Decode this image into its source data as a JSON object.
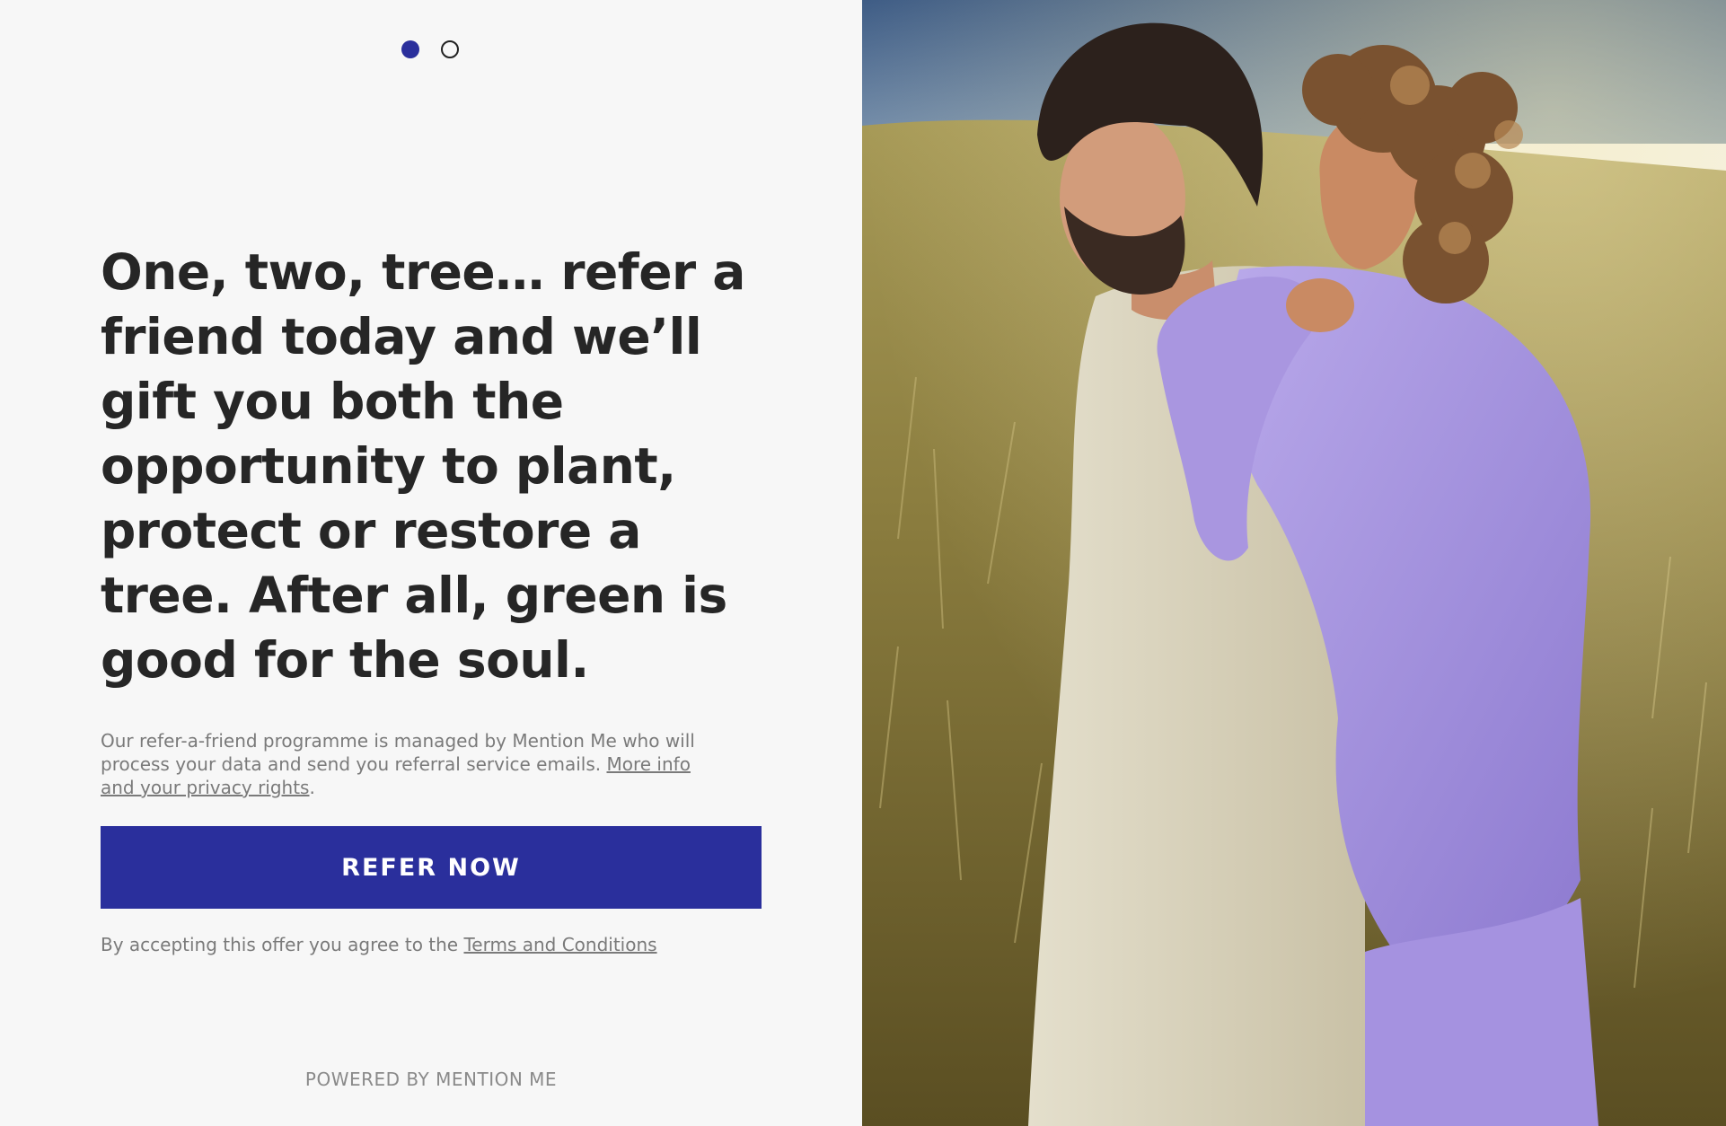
{
  "pager": {
    "slides": [
      "active",
      "inactive"
    ]
  },
  "headline": "One, two, tree… refer a friend today and we’ll gift you both the opportunity to plant, protect or restore a tree. After all, green is good for the soul.",
  "disclaimer": {
    "text": "Our refer-a-friend programme is managed by Mention Me who will process your data and send you referral service emails. ",
    "link": "More info and your privacy rights",
    "suffix": "."
  },
  "cta": {
    "label": "REFER NOW"
  },
  "terms": {
    "prefix": "By accepting this offer you agree to the ",
    "link": "Terms and Conditions"
  },
  "footer": {
    "powered_by": "POWERED BY MENTION ME"
  },
  "colors": {
    "accent": "#2a2f9c",
    "background": "#f7f7f7",
    "headline": "#262626",
    "muted_text": "#7a7a7a"
  },
  "image": {
    "subject": "couple-in-grass-field-photo"
  }
}
